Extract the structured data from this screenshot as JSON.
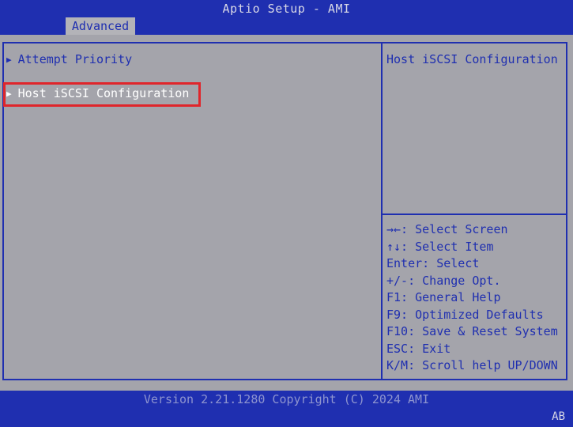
{
  "window": {
    "title": "Aptio Setup - AMI"
  },
  "tabs": [
    {
      "label": "Advanced",
      "active": true
    }
  ],
  "menu": {
    "items": [
      {
        "label": "Attempt Priority",
        "selected": false
      },
      {
        "label": "Host iSCSI Configuration",
        "selected": true
      }
    ]
  },
  "help": {
    "description": "Host iSCSI Configuration",
    "keys": [
      "→←: Select Screen",
      "↑↓: Select Item",
      "Enter: Select",
      "+/-: Change Opt.",
      "F1: General Help",
      "F9: Optimized Defaults",
      "F10: Save & Reset System",
      "ESC: Exit",
      "K/M: Scroll help UP/DOWN"
    ]
  },
  "footer": {
    "version": "Version 2.21.1280 Copyright (C) 2024 AMI",
    "corner": "AB"
  },
  "colors": {
    "background": "#1f2fb0",
    "panel": "#a4a4ab",
    "highlight": "#e0252b",
    "text": "#1f2fb0"
  }
}
